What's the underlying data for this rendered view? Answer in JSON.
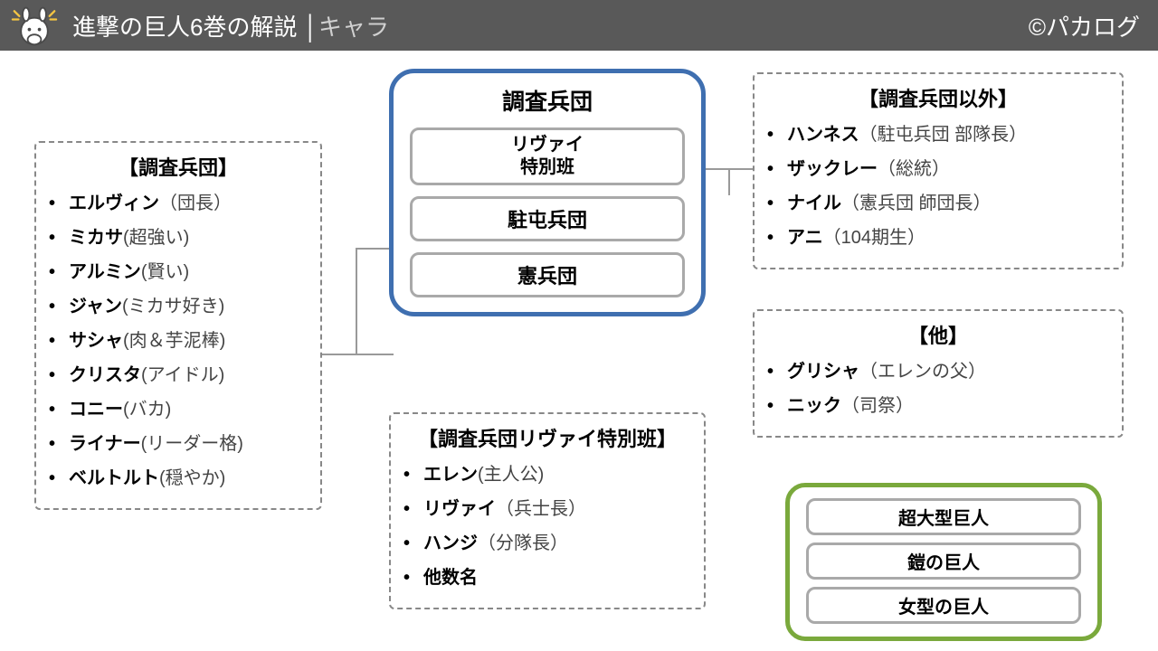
{
  "header": {
    "title_main": "進撃の巨人6巻の解説",
    "title_sep": " │",
    "title_sub": "キャラ",
    "credit": "©パカログ"
  },
  "left_box": {
    "title": "【調査兵団】",
    "items": [
      {
        "name": "エルヴィン",
        "note": "（団長）"
      },
      {
        "name": "ミカサ",
        "note": "(超強い)"
      },
      {
        "name": "アルミン",
        "note": "(賢い)"
      },
      {
        "name": "ジャン",
        "note": "(ミカサ好き)"
      },
      {
        "name": "サシャ",
        "note": "(肉＆芋泥棒)"
      },
      {
        "name": "クリスタ",
        "note": "(アイドル)"
      },
      {
        "name": "コニー",
        "note": "(バカ)"
      },
      {
        "name": "ライナー",
        "note": "(リーダー格)"
      },
      {
        "name": "ベルトルト",
        "note": "(穏やか)"
      }
    ]
  },
  "blue_group": {
    "main_title": "調査兵団",
    "sub_box": "リヴァイ\n特別班",
    "row2": "駐屯兵団",
    "row3": "憲兵団"
  },
  "center_box": {
    "title": "【調査兵団リヴァイ特別班】",
    "items": [
      {
        "name": "エレン",
        "note": "(主人公)"
      },
      {
        "name": "リヴァイ",
        "note": "（兵士長）"
      },
      {
        "name": "ハンジ",
        "note": "（分隊長）"
      },
      {
        "name": "他数名",
        "note": ""
      }
    ]
  },
  "right_top": {
    "title": "【調査兵団以外】",
    "items": [
      {
        "name": "ハンネス",
        "note": "（駐屯兵団 部隊長）"
      },
      {
        "name": "ザックレー",
        "note": "（総統）"
      },
      {
        "name": "ナイル",
        "note": "（憲兵団 師団長）"
      },
      {
        "name": "アニ",
        "note": "（104期生）"
      }
    ]
  },
  "right_mid": {
    "title": "【他】",
    "items": [
      {
        "name": "グリシャ",
        "note": "（エレンの父）"
      },
      {
        "name": "ニック",
        "note": "（司祭）"
      }
    ]
  },
  "green_group": {
    "rows": [
      "超大型巨人",
      "鎧の巨人",
      "女型の巨人"
    ]
  }
}
